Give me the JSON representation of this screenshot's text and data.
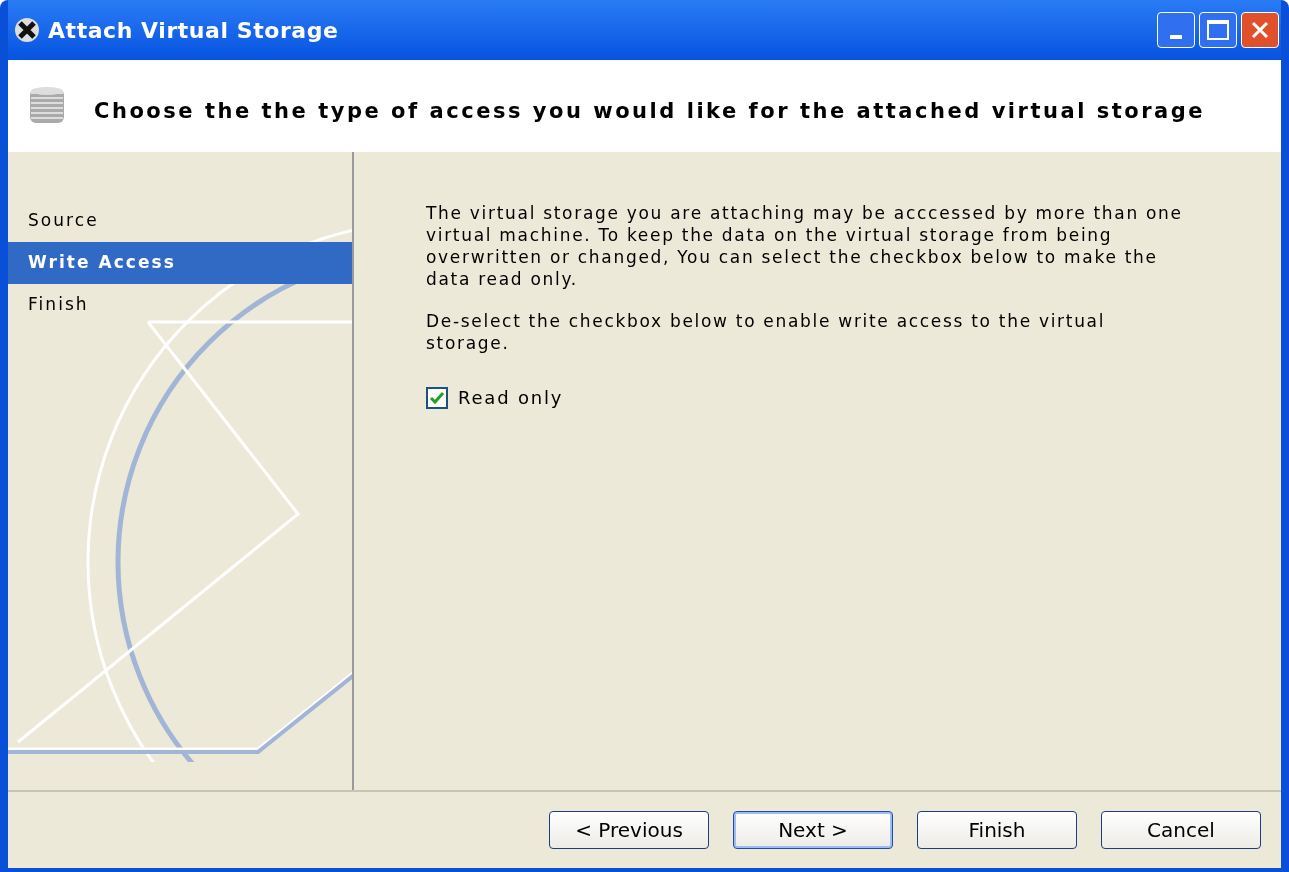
{
  "window": {
    "title": "Attach Virtual Storage"
  },
  "header": {
    "title": "Choose the the type of access you would like for the attached virtual storage"
  },
  "steps": [
    {
      "label": "Source",
      "selected": false
    },
    {
      "label": "Write Access",
      "selected": true
    },
    {
      "label": "Finish",
      "selected": false
    }
  ],
  "content": {
    "paragraphs": [
      "The virtual storage you are attaching may be acccessed by more than one virtual machine. To keep the data on the virtual storage from being overwritten or changed, You can select the checkbox below to make the data read only.",
      "De-select the checkbox below to enable write access to the virtual storage."
    ],
    "checkbox": {
      "label": "Read only",
      "checked": true
    }
  },
  "buttons": [
    {
      "label": "< Previous",
      "default": false
    },
    {
      "label": "Next >",
      "default": true
    },
    {
      "label": "Finish",
      "default": false
    },
    {
      "label": "Cancel",
      "default": false
    }
  ]
}
